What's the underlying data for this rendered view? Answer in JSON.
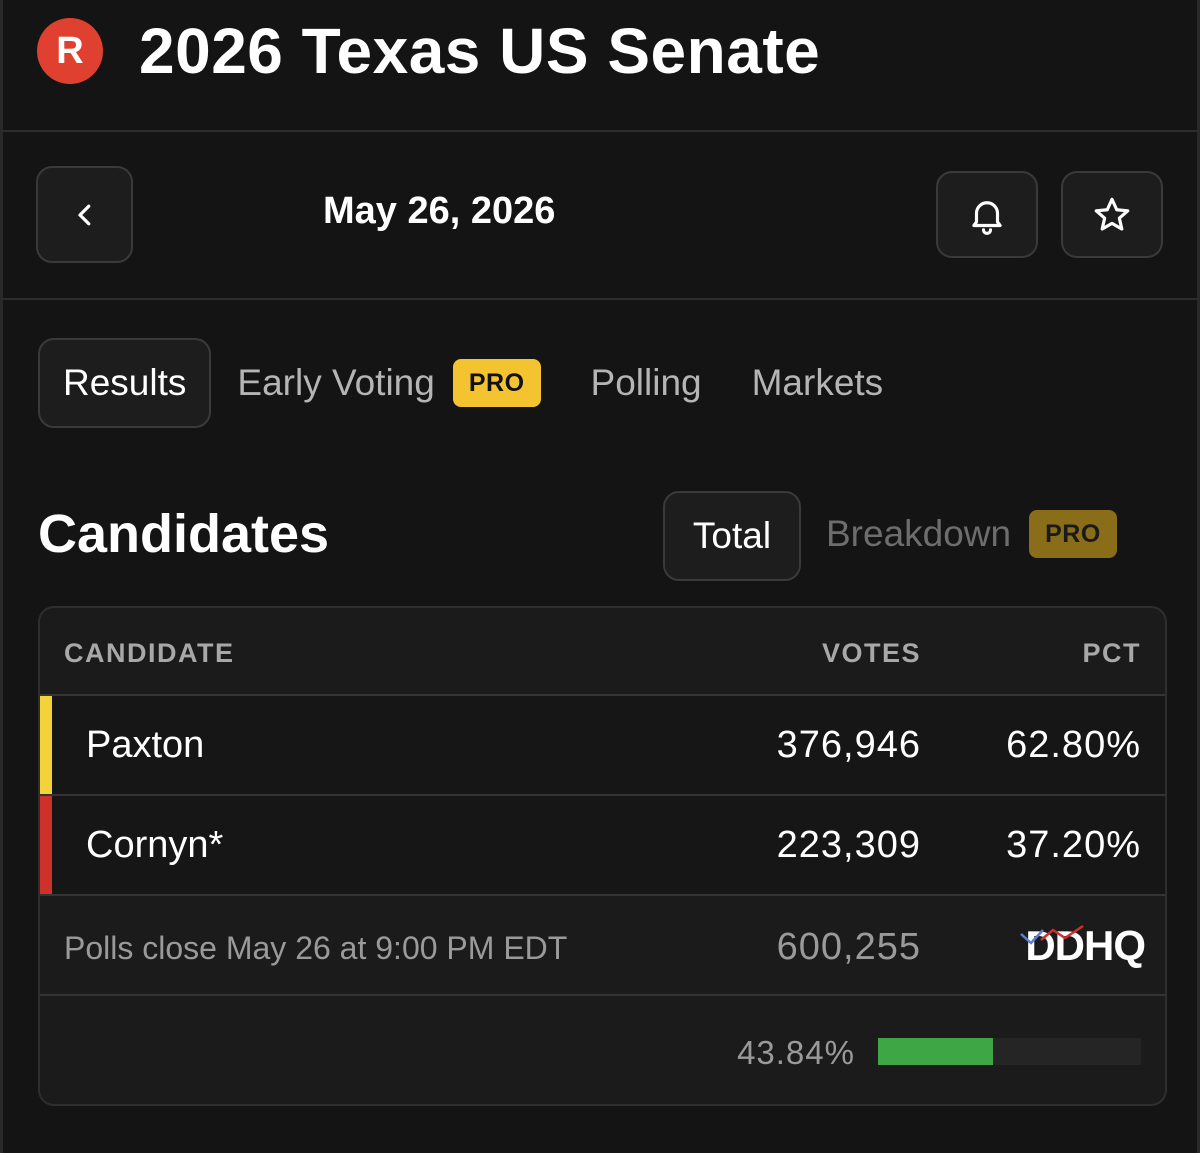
{
  "header": {
    "party_letter": "R",
    "party_color": "#e0402f",
    "title": "2026 Texas US Senate"
  },
  "datebar": {
    "date": "May 26, 2026",
    "icons": [
      "chevron-left-icon",
      "bell-icon",
      "star-icon"
    ]
  },
  "tabs": [
    {
      "label": "Results",
      "active": true
    },
    {
      "label": "Early Voting",
      "badge": "PRO"
    },
    {
      "label": "Polling"
    },
    {
      "label": "Markets"
    }
  ],
  "candidates": {
    "title": "Candidates",
    "toggle": {
      "total": "Total",
      "breakdown": "Breakdown",
      "breakdown_badge": "PRO"
    },
    "columns": {
      "candidate": "CANDIDATE",
      "votes": "VOTES",
      "pct": "PCT"
    },
    "rows": [
      {
        "name": "Paxton",
        "votes": "376,946",
        "pct": "62.80%",
        "color": "#f2d33a"
      },
      {
        "name": "Cornyn*",
        "votes": "223,309",
        "pct": "37.20%",
        "color": "#d0302a"
      }
    ],
    "footer": {
      "polls_close": "Polls close May 26 at 9:00 PM EDT",
      "total_votes": "600,255",
      "source_logo": "DDHQ"
    },
    "reporting": {
      "pct_label": "43.84%",
      "fraction": 0.4384,
      "fill_color": "#3fa645"
    }
  }
}
